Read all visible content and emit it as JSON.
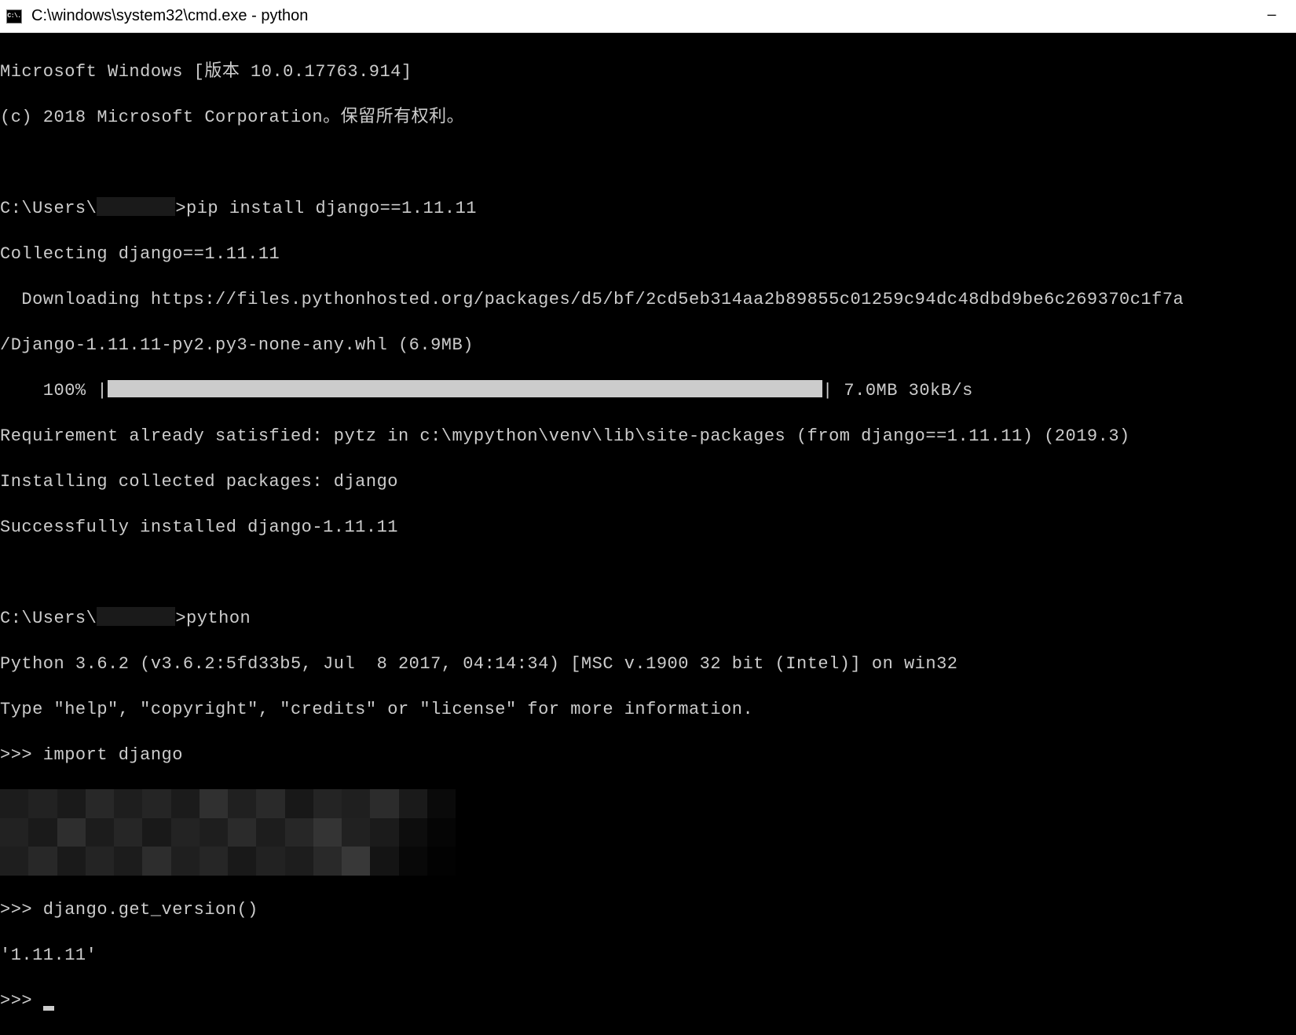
{
  "window": {
    "title": "C:\\windows\\system32\\cmd.exe - python",
    "icon_label": "C:\\."
  },
  "terminal": {
    "header_line1": "Microsoft Windows [版本 10.0.17763.914]",
    "header_line2": "(c) 2018 Microsoft Corporation。保留所有权利。",
    "prompt1_prefix": "C:\\Users\\",
    "prompt1_suffix": ">pip install django==1.11.11",
    "collecting": "Collecting django==1.11.11",
    "downloading": "  Downloading https://files.pythonhosted.org/packages/d5/bf/2cd5eb314aa2b89855c01259c94dc48dbd9be6c269370c1f7a",
    "wheel_line": "/Django-1.11.11-py2.py3-none-any.whl (6.9MB)",
    "progress_prefix": "    100% |",
    "progress_suffix": "| 7.0MB 30kB/s",
    "requirement": "Requirement already satisfied: pytz in c:\\mypython\\venv\\lib\\site-packages (from django==1.11.11) (2019.3)",
    "installing": "Installing collected packages: django",
    "success": "Successfully installed django-1.11.11",
    "prompt2_prefix": "C:\\Users\\",
    "prompt2_suffix": ">python",
    "python_version": "Python 3.6.2 (v3.6.2:5fd33b5, Jul  8 2017, 04:14:34) [MSC v.1900 32 bit (Intel)] on win32",
    "python_help": "Type \"help\", \"copyright\", \"credits\" or \"license\" for more information.",
    "repl1": ">>> import django",
    "repl2": ">>> django.get_version()",
    "repl2_out": "'1.11.11'",
    "repl3": ">>> "
  }
}
